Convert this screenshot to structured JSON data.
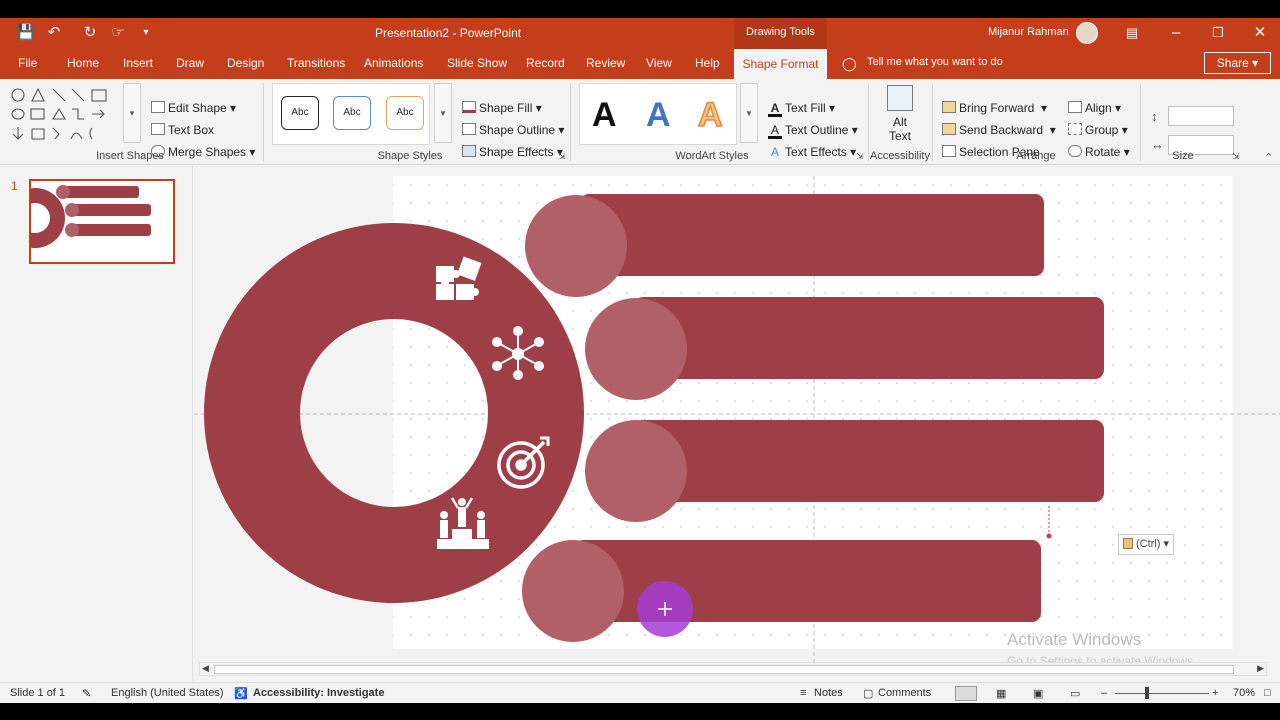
{
  "titlebar": {
    "title": "Presentation2 - PowerPoint",
    "context_tab": "Drawing Tools",
    "user": "Mijanur Rahman"
  },
  "tabs": [
    "File",
    "Home",
    "Insert",
    "Draw",
    "Design",
    "Transitions",
    "Animations",
    "Slide Show",
    "Record",
    "Review",
    "View",
    "Help"
  ],
  "active_tab": "Shape Format",
  "tell_me": "Tell me what you want to do",
  "share": "Share",
  "ribbon": {
    "insert_shapes": {
      "label": "Insert Shapes",
      "edit_shape": "Edit Shape",
      "text_box": "Text Box",
      "merge_shapes": "Merge Shapes"
    },
    "shape_styles": {
      "label": "Shape Styles",
      "preset": [
        "Abc",
        "Abc",
        "Abc"
      ],
      "shape_fill": "Shape Fill",
      "shape_outline": "Shape Outline",
      "shape_effects": "Shape Effects"
    },
    "wordart": {
      "label": "WordArt Styles",
      "letters": [
        "A",
        "A",
        "A"
      ],
      "text_fill": "Text Fill",
      "text_outline": "Text Outline",
      "text_effects": "Text Effects"
    },
    "accessibility": {
      "label": "Accessibility",
      "alt_text_line1": "Alt",
      "alt_text_line2": "Text"
    },
    "arrange": {
      "label": "Arrange",
      "bring_forward": "Bring Forward",
      "send_backward": "Send Backward",
      "selection_pane": "Selection Pane",
      "align": "Align",
      "group": "Group",
      "rotate": "Rotate"
    },
    "size": {
      "label": "Size"
    }
  },
  "thumbnail": {
    "number": "1"
  },
  "canvas": {
    "paste_options": "(Ctrl)",
    "watermark_title": "Activate Windows",
    "watermark_sub": "Go to Settings to activate Windows."
  },
  "status": {
    "slide": "Slide 1 of 1",
    "language": "English (United States)",
    "accessibility": "Accessibility: Investigate",
    "notes": "Notes",
    "comments": "Comments",
    "zoom": "70%"
  },
  "colors": {
    "accent": "#c43e1c",
    "shape_dark": "#9e3f48",
    "shape_light": "#b06066",
    "cursor": "#a63cd6"
  }
}
